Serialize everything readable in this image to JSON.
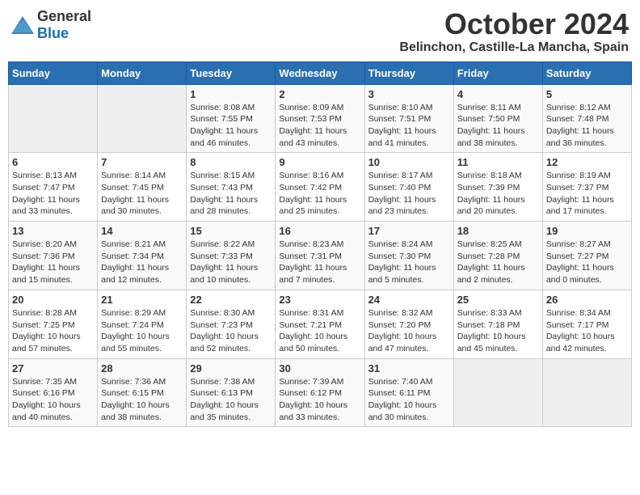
{
  "header": {
    "logo_general": "General",
    "logo_blue": "Blue",
    "month": "October 2024",
    "location": "Belinchon, Castille-La Mancha, Spain"
  },
  "calendar": {
    "weekdays": [
      "Sunday",
      "Monday",
      "Tuesday",
      "Wednesday",
      "Thursday",
      "Friday",
      "Saturday"
    ],
    "weeks": [
      [
        {
          "day": "",
          "info": ""
        },
        {
          "day": "",
          "info": ""
        },
        {
          "day": "1",
          "info": "Sunrise: 8:08 AM\nSunset: 7:55 PM\nDaylight: 11 hours and 46 minutes."
        },
        {
          "day": "2",
          "info": "Sunrise: 8:09 AM\nSunset: 7:53 PM\nDaylight: 11 hours and 43 minutes."
        },
        {
          "day": "3",
          "info": "Sunrise: 8:10 AM\nSunset: 7:51 PM\nDaylight: 11 hours and 41 minutes."
        },
        {
          "day": "4",
          "info": "Sunrise: 8:11 AM\nSunset: 7:50 PM\nDaylight: 11 hours and 38 minutes."
        },
        {
          "day": "5",
          "info": "Sunrise: 8:12 AM\nSunset: 7:48 PM\nDaylight: 11 hours and 36 minutes."
        }
      ],
      [
        {
          "day": "6",
          "info": "Sunrise: 8:13 AM\nSunset: 7:47 PM\nDaylight: 11 hours and 33 minutes."
        },
        {
          "day": "7",
          "info": "Sunrise: 8:14 AM\nSunset: 7:45 PM\nDaylight: 11 hours and 30 minutes."
        },
        {
          "day": "8",
          "info": "Sunrise: 8:15 AM\nSunset: 7:43 PM\nDaylight: 11 hours and 28 minutes."
        },
        {
          "day": "9",
          "info": "Sunrise: 8:16 AM\nSunset: 7:42 PM\nDaylight: 11 hours and 25 minutes."
        },
        {
          "day": "10",
          "info": "Sunrise: 8:17 AM\nSunset: 7:40 PM\nDaylight: 11 hours and 23 minutes."
        },
        {
          "day": "11",
          "info": "Sunrise: 8:18 AM\nSunset: 7:39 PM\nDaylight: 11 hours and 20 minutes."
        },
        {
          "day": "12",
          "info": "Sunrise: 8:19 AM\nSunset: 7:37 PM\nDaylight: 11 hours and 17 minutes."
        }
      ],
      [
        {
          "day": "13",
          "info": "Sunrise: 8:20 AM\nSunset: 7:36 PM\nDaylight: 11 hours and 15 minutes."
        },
        {
          "day": "14",
          "info": "Sunrise: 8:21 AM\nSunset: 7:34 PM\nDaylight: 11 hours and 12 minutes."
        },
        {
          "day": "15",
          "info": "Sunrise: 8:22 AM\nSunset: 7:33 PM\nDaylight: 11 hours and 10 minutes."
        },
        {
          "day": "16",
          "info": "Sunrise: 8:23 AM\nSunset: 7:31 PM\nDaylight: 11 hours and 7 minutes."
        },
        {
          "day": "17",
          "info": "Sunrise: 8:24 AM\nSunset: 7:30 PM\nDaylight: 11 hours and 5 minutes."
        },
        {
          "day": "18",
          "info": "Sunrise: 8:25 AM\nSunset: 7:28 PM\nDaylight: 11 hours and 2 minutes."
        },
        {
          "day": "19",
          "info": "Sunrise: 8:27 AM\nSunset: 7:27 PM\nDaylight: 11 hours and 0 minutes."
        }
      ],
      [
        {
          "day": "20",
          "info": "Sunrise: 8:28 AM\nSunset: 7:25 PM\nDaylight: 10 hours and 57 minutes."
        },
        {
          "day": "21",
          "info": "Sunrise: 8:29 AM\nSunset: 7:24 PM\nDaylight: 10 hours and 55 minutes."
        },
        {
          "day": "22",
          "info": "Sunrise: 8:30 AM\nSunset: 7:23 PM\nDaylight: 10 hours and 52 minutes."
        },
        {
          "day": "23",
          "info": "Sunrise: 8:31 AM\nSunset: 7:21 PM\nDaylight: 10 hours and 50 minutes."
        },
        {
          "day": "24",
          "info": "Sunrise: 8:32 AM\nSunset: 7:20 PM\nDaylight: 10 hours and 47 minutes."
        },
        {
          "day": "25",
          "info": "Sunrise: 8:33 AM\nSunset: 7:18 PM\nDaylight: 10 hours and 45 minutes."
        },
        {
          "day": "26",
          "info": "Sunrise: 8:34 AM\nSunset: 7:17 PM\nDaylight: 10 hours and 42 minutes."
        }
      ],
      [
        {
          "day": "27",
          "info": "Sunrise: 7:35 AM\nSunset: 6:16 PM\nDaylight: 10 hours and 40 minutes."
        },
        {
          "day": "28",
          "info": "Sunrise: 7:36 AM\nSunset: 6:15 PM\nDaylight: 10 hours and 38 minutes."
        },
        {
          "day": "29",
          "info": "Sunrise: 7:38 AM\nSunset: 6:13 PM\nDaylight: 10 hours and 35 minutes."
        },
        {
          "day": "30",
          "info": "Sunrise: 7:39 AM\nSunset: 6:12 PM\nDaylight: 10 hours and 33 minutes."
        },
        {
          "day": "31",
          "info": "Sunrise: 7:40 AM\nSunset: 6:11 PM\nDaylight: 10 hours and 30 minutes."
        },
        {
          "day": "",
          "info": ""
        },
        {
          "day": "",
          "info": ""
        }
      ]
    ]
  }
}
